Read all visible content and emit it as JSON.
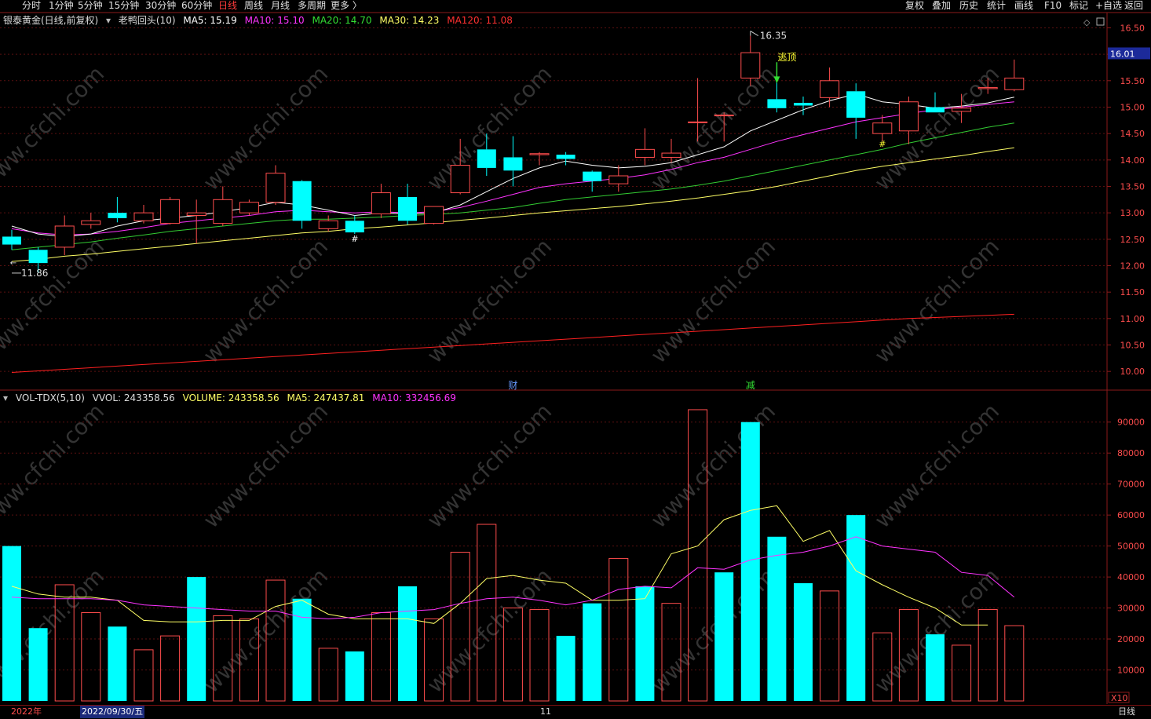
{
  "toolbar": {
    "timeframes": [
      "分时",
      "1分钟",
      "5分钟",
      "15分钟",
      "30分钟",
      "60分钟",
      "日线",
      "周线",
      "月线",
      "多周期",
      "更多 〉"
    ],
    "active_timeframe": "日线",
    "buttons": [
      "复权",
      "叠加",
      "历史",
      "统计",
      "画线",
      "F10",
      "标记",
      "+自选",
      "返回"
    ]
  },
  "price_header": {
    "stock": "银泰黄金(日线,前复权)",
    "indicator": "老鸭回头(10)",
    "ma5": "MA5: 15.19",
    "ma10": "MA10: 15.10",
    "ma20": "MA20: 14.70",
    "ma30": "MA30: 14.23",
    "ma120": "MA120: 11.08"
  },
  "vol_header": {
    "name": "VOL-TDX(5,10)",
    "vvol": "VVOL: 243358.56",
    "volume": "VOLUME: 243358.56",
    "ma5": "MA5: 247437.81",
    "ma10": "MA10: 332456.69"
  },
  "annotations": {
    "high_label": "16.35",
    "low_label": "11.86",
    "escape_top": "逃顶",
    "hash": "#",
    "cai": "财",
    "jian": "减",
    "current_price": "16.01",
    "vol_multiplier": "X10"
  },
  "bottom": {
    "year": "2022年",
    "date": "2022/09/30/五",
    "month": "11",
    "period": "日线"
  },
  "watermark": "www.cfchi.com",
  "colors": {
    "up": "#ff4d4d",
    "down": "#00ffff",
    "ma5": "#ffffff",
    "ma10": "#ff33ff",
    "ma20": "#33cc33",
    "ma30": "#ffff66",
    "ma120": "#ff2020",
    "axis": "#8b1a1a"
  },
  "chart_data": [
    {
      "type": "candlestick",
      "y_axis_ticks": [
        10.0,
        10.5,
        11.0,
        11.5,
        12.0,
        12.5,
        13.0,
        13.5,
        14.0,
        14.5,
        15.0,
        15.5,
        16.0,
        16.5
      ],
      "ylim": [
        9.75,
        16.7
      ],
      "candles": [
        {
          "o": 12.55,
          "h": 12.68,
          "l": 12.3,
          "c": 12.4
        },
        {
          "o": 12.3,
          "h": 12.35,
          "l": 11.86,
          "c": 12.05
        },
        {
          "o": 12.35,
          "h": 12.95,
          "l": 12.2,
          "c": 12.75
        },
        {
          "o": 12.78,
          "h": 13.0,
          "l": 12.7,
          "c": 12.85
        },
        {
          "o": 13.0,
          "h": 13.3,
          "l": 12.82,
          "c": 12.9
        },
        {
          "o": 12.85,
          "h": 13.15,
          "l": 12.8,
          "c": 13.0
        },
        {
          "o": 12.8,
          "h": 13.3,
          "l": 12.78,
          "c": 13.25
        },
        {
          "o": 12.95,
          "h": 13.25,
          "l": 12.42,
          "c": 13.0
        },
        {
          "o": 12.8,
          "h": 13.5,
          "l": 12.75,
          "c": 13.25
        },
        {
          "o": 13.0,
          "h": 13.25,
          "l": 12.95,
          "c": 13.2
        },
        {
          "o": 13.2,
          "h": 13.9,
          "l": 13.15,
          "c": 13.75
        },
        {
          "o": 13.6,
          "h": 13.62,
          "l": 12.7,
          "c": 12.85
        },
        {
          "o": 12.7,
          "h": 12.95,
          "l": 12.65,
          "c": 12.85
        },
        {
          "o": 12.85,
          "h": 12.95,
          "l": 12.6,
          "c": 12.63
        },
        {
          "o": 12.98,
          "h": 13.55,
          "l": 12.9,
          "c": 13.38
        },
        {
          "o": 13.3,
          "h": 13.55,
          "l": 12.78,
          "c": 12.85
        },
        {
          "o": 12.8,
          "h": 13.1,
          "l": 12.78,
          "c": 13.12
        },
        {
          "o": 13.38,
          "h": 14.4,
          "l": 13.35,
          "c": 13.9
        },
        {
          "o": 14.2,
          "h": 14.5,
          "l": 13.7,
          "c": 13.85
        },
        {
          "o": 14.05,
          "h": 14.45,
          "l": 13.5,
          "c": 13.8
        },
        {
          "o": 14.1,
          "h": 14.15,
          "l": 13.9,
          "c": 14.12
        },
        {
          "o": 14.1,
          "h": 14.15,
          "l": 13.9,
          "c": 14.02
        },
        {
          "o": 13.78,
          "h": 13.8,
          "l": 13.4,
          "c": 13.6
        },
        {
          "o": 13.55,
          "h": 13.9,
          "l": 13.4,
          "c": 13.7
        },
        {
          "o": 14.05,
          "h": 14.6,
          "l": 13.9,
          "c": 14.2
        },
        {
          "o": 14.05,
          "h": 14.4,
          "l": 13.95,
          "c": 14.13
        },
        {
          "o": 14.72,
          "h": 15.55,
          "l": 14.35,
          "c": 14.72
        },
        {
          "o": 14.85,
          "h": 14.9,
          "l": 14.35,
          "c": 14.85
        },
        {
          "o": 15.55,
          "h": 16.35,
          "l": 15.4,
          "c": 16.03
        },
        {
          "o": 15.15,
          "h": 15.6,
          "l": 14.9,
          "c": 14.98
        },
        {
          "o": 15.08,
          "h": 15.2,
          "l": 14.85,
          "c": 15.03
        },
        {
          "o": 15.18,
          "h": 15.75,
          "l": 15.0,
          "c": 15.5
        },
        {
          "o": 15.3,
          "h": 15.45,
          "l": 14.4,
          "c": 14.8
        },
        {
          "o": 14.5,
          "h": 14.85,
          "l": 14.35,
          "c": 14.7
        },
        {
          "o": 14.55,
          "h": 15.2,
          "l": 14.3,
          "c": 15.1
        },
        {
          "o": 15.0,
          "h": 15.28,
          "l": 14.9,
          "c": 14.9
        },
        {
          "o": 14.92,
          "h": 15.25,
          "l": 14.7,
          "c": 14.98
        },
        {
          "o": 15.35,
          "h": 15.55,
          "l": 15.25,
          "c": 15.37
        },
        {
          "o": 15.33,
          "h": 15.9,
          "l": 15.3,
          "c": 15.55
        }
      ],
      "ma5": [
        12.75,
        12.6,
        12.55,
        12.6,
        12.75,
        12.85,
        12.9,
        12.95,
        13.02,
        13.1,
        13.2,
        13.15,
        13.05,
        12.95,
        13.0,
        12.98,
        13.0,
        13.15,
        13.4,
        13.65,
        13.85,
        13.98,
        13.9,
        13.85,
        13.88,
        13.95,
        14.1,
        14.25,
        14.55,
        14.75,
        14.95,
        15.12,
        15.25,
        15.1,
        15.05,
        14.98,
        15.02,
        15.08,
        15.19
      ],
      "ma10": [
        12.7,
        12.62,
        12.58,
        12.6,
        12.65,
        12.72,
        12.8,
        12.85,
        12.9,
        12.95,
        13.02,
        13.05,
        13.02,
        13.0,
        13.02,
        13.0,
        13.02,
        13.1,
        13.22,
        13.35,
        13.48,
        13.55,
        13.6,
        13.65,
        13.72,
        13.82,
        13.95,
        14.05,
        14.2,
        14.35,
        14.48,
        14.6,
        14.72,
        14.8,
        14.88,
        14.95,
        15.0,
        15.05,
        15.1
      ],
      "ma20": [
        12.3,
        12.35,
        12.4,
        12.45,
        12.52,
        12.58,
        12.65,
        12.7,
        12.75,
        12.8,
        12.85,
        12.88,
        12.88,
        12.9,
        12.92,
        12.95,
        12.97,
        13.0,
        13.05,
        13.1,
        13.18,
        13.25,
        13.3,
        13.35,
        13.4,
        13.45,
        13.52,
        13.6,
        13.7,
        13.8,
        13.9,
        14.0,
        14.1,
        14.2,
        14.32,
        14.42,
        14.52,
        14.62,
        14.7
      ],
      "ma30": [
        12.08,
        12.12,
        12.18,
        12.22,
        12.27,
        12.32,
        12.37,
        12.42,
        12.47,
        12.52,
        12.57,
        12.62,
        12.65,
        12.7,
        12.73,
        12.77,
        12.81,
        12.86,
        12.9,
        12.95,
        13.0,
        13.04,
        13.08,
        13.12,
        13.17,
        13.22,
        13.28,
        13.35,
        13.42,
        13.5,
        13.6,
        13.7,
        13.8,
        13.88,
        13.95,
        14.02,
        14.08,
        14.16,
        14.23
      ],
      "ma120": [
        9.98,
        10.01,
        10.04,
        10.07,
        10.1,
        10.13,
        10.16,
        10.19,
        10.22,
        10.25,
        10.28,
        10.31,
        10.34,
        10.37,
        10.4,
        10.43,
        10.46,
        10.49,
        10.52,
        10.55,
        10.58,
        10.61,
        10.64,
        10.67,
        10.7,
        10.73,
        10.76,
        10.79,
        10.82,
        10.85,
        10.88,
        10.91,
        10.94,
        10.97,
        11.0,
        11.02,
        11.04,
        11.06,
        11.08
      ]
    },
    {
      "type": "bar",
      "y_axis_ticks": [
        10000,
        20000,
        30000,
        40000,
        50000,
        60000,
        70000,
        80000,
        90000
      ],
      "ylim": [
        0,
        95000
      ],
      "volumes": [
        50000,
        23500,
        37500,
        28500,
        24000,
        16500,
        21000,
        40000,
        27500,
        26500,
        39000,
        33000,
        17000,
        16000,
        28500,
        37000,
        26500,
        48000,
        57000,
        30000,
        29500,
        21000,
        31500,
        46000,
        37000,
        31500,
        94000,
        41500,
        90000,
        53000,
        38000,
        35500,
        60000,
        22000,
        29500,
        21500,
        18000,
        29500,
        24300
      ],
      "up_down": [
        "down",
        "down",
        "up",
        "up",
        "down",
        "up",
        "up",
        "down",
        "up",
        "up",
        "up",
        "down",
        "up",
        "down",
        "up",
        "down",
        "up",
        "up",
        "up",
        "up",
        "up",
        "down",
        "down",
        "up",
        "down",
        "up",
        "up",
        "down",
        "down",
        "down",
        "down",
        "up",
        "down",
        "up",
        "up",
        "down",
        "up",
        "up",
        "up"
      ],
      "ma5": [
        37000,
        34500,
        33500,
        33500,
        32500,
        26000,
        25500,
        25500,
        26000,
        26000,
        30500,
        32500,
        28000,
        26500,
        26500,
        26500,
        25000,
        31500,
        39500,
        40500,
        39000,
        38000,
        32500,
        32500,
        33000,
        47500,
        50000,
        58500,
        61500,
        63000,
        51500,
        55000,
        42000,
        37500,
        33500,
        30000,
        24500,
        24500
      ],
      "ma10": [
        33500,
        33000,
        33000,
        33000,
        32500,
        31000,
        30500,
        30000,
        29500,
        29000,
        29000,
        27000,
        26500,
        27000,
        28500,
        29000,
        29500,
        31500,
        33000,
        33500,
        32500,
        31000,
        32500,
        36000,
        37000,
        36500,
        43000,
        42500,
        45500,
        47000,
        48000,
        50000,
        53000,
        50000,
        49000,
        48000,
        41500,
        40500,
        33500
      ]
    }
  ]
}
